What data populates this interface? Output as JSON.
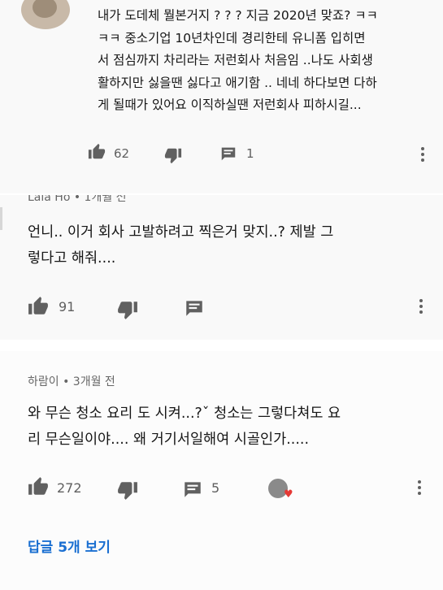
{
  "comments": [
    {
      "text_lines": [
        "내가 도데체 뭘본거지 ? ? ? 지금 2020년 맞죠? ㅋㅋ",
        "ㅋㅋ 중소기업 10년차인데 경리한테 유니폼 입히면",
        "서 점심까지 차리라는  저런회사 처음임 ..나도 사회생",
        "활하지만 싫을땐 싫다고 애기함 .. 네네 하다보면 다하",
        "게 될때가 있어요 이직하실땐 저런회사 피하시길..."
      ],
      "likes": "62",
      "replies": "1"
    },
    {
      "author": "Lala Ho",
      "time": "• 1개월 전",
      "text_lines": [
        "언니.. 이거 회사 고발하려고 찍은거 맞지..? 제발 그",
        "렇다고 해줘...."
      ],
      "likes": "91"
    },
    {
      "author": "하람이",
      "time": "• 3개월 전",
      "text_lines": [
        "와 무슨 청소 요리 도 시켜...?ˇ 청소는 그렇다쳐도 요",
        "리 무슨일이야.... 왜 거기서일해여 시골인가....."
      ],
      "likes": "272",
      "replies": "5",
      "view_replies": "답글 5개 보기"
    }
  ],
  "icons": {
    "like": "thumbs-up-icon",
    "dislike": "thumbs-down-icon",
    "reply": "comment-icon",
    "more": "more-vert-icon",
    "heart": "heart-icon"
  },
  "colors": {
    "link": "#1a6fd1",
    "heart": "#e53935"
  }
}
